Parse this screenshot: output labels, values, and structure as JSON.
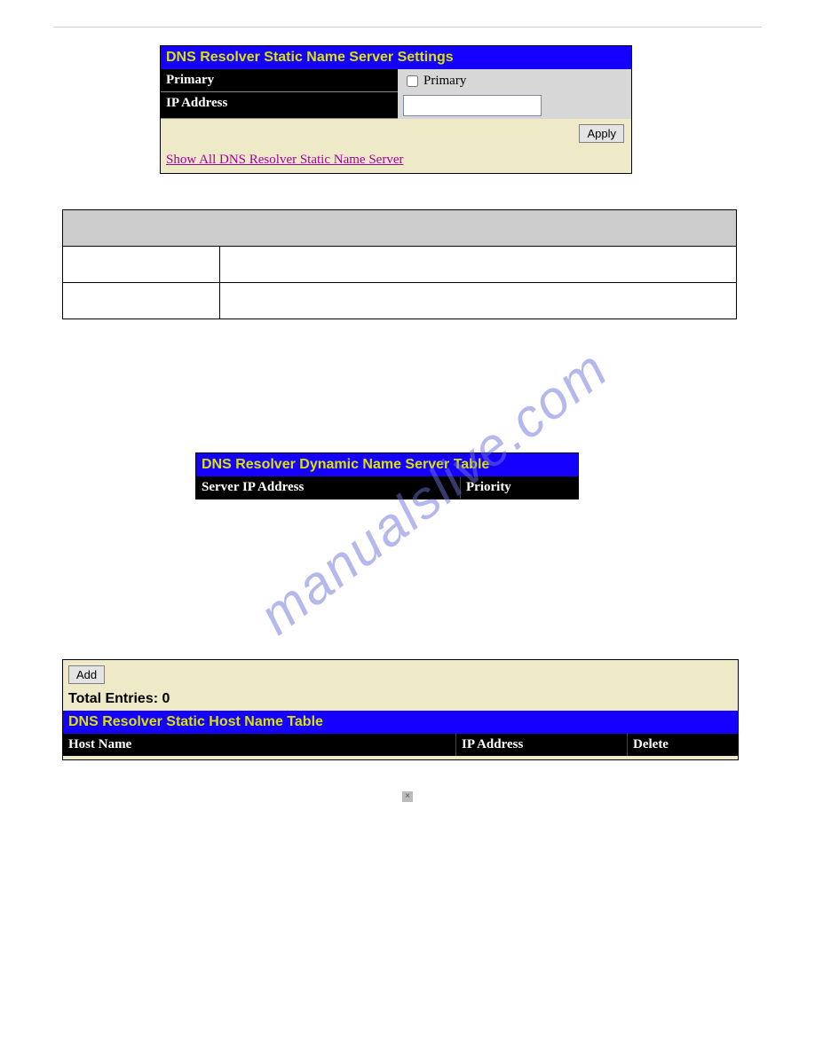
{
  "panel1": {
    "title": "DNS Resolver Static Name Server Settings",
    "rows": {
      "primary_label": "Primary",
      "primary_checkbox_label": "Primary",
      "ip_label": "IP Address"
    },
    "apply": "Apply",
    "link": "Show All DNS Resolver Static Name Server"
  },
  "panel2": {
    "title": "DNS Resolver Dynamic Name Server Table",
    "cols": {
      "server_ip": "Server IP Address",
      "priority": "Priority"
    }
  },
  "panel3": {
    "add": "Add",
    "total": "Total Entries: 0",
    "title": "DNS Resolver Static Host Name Table",
    "cols": {
      "host": "Host Name",
      "ip": "IP Address",
      "del": "Delete"
    }
  },
  "watermark": "manualslive.com"
}
